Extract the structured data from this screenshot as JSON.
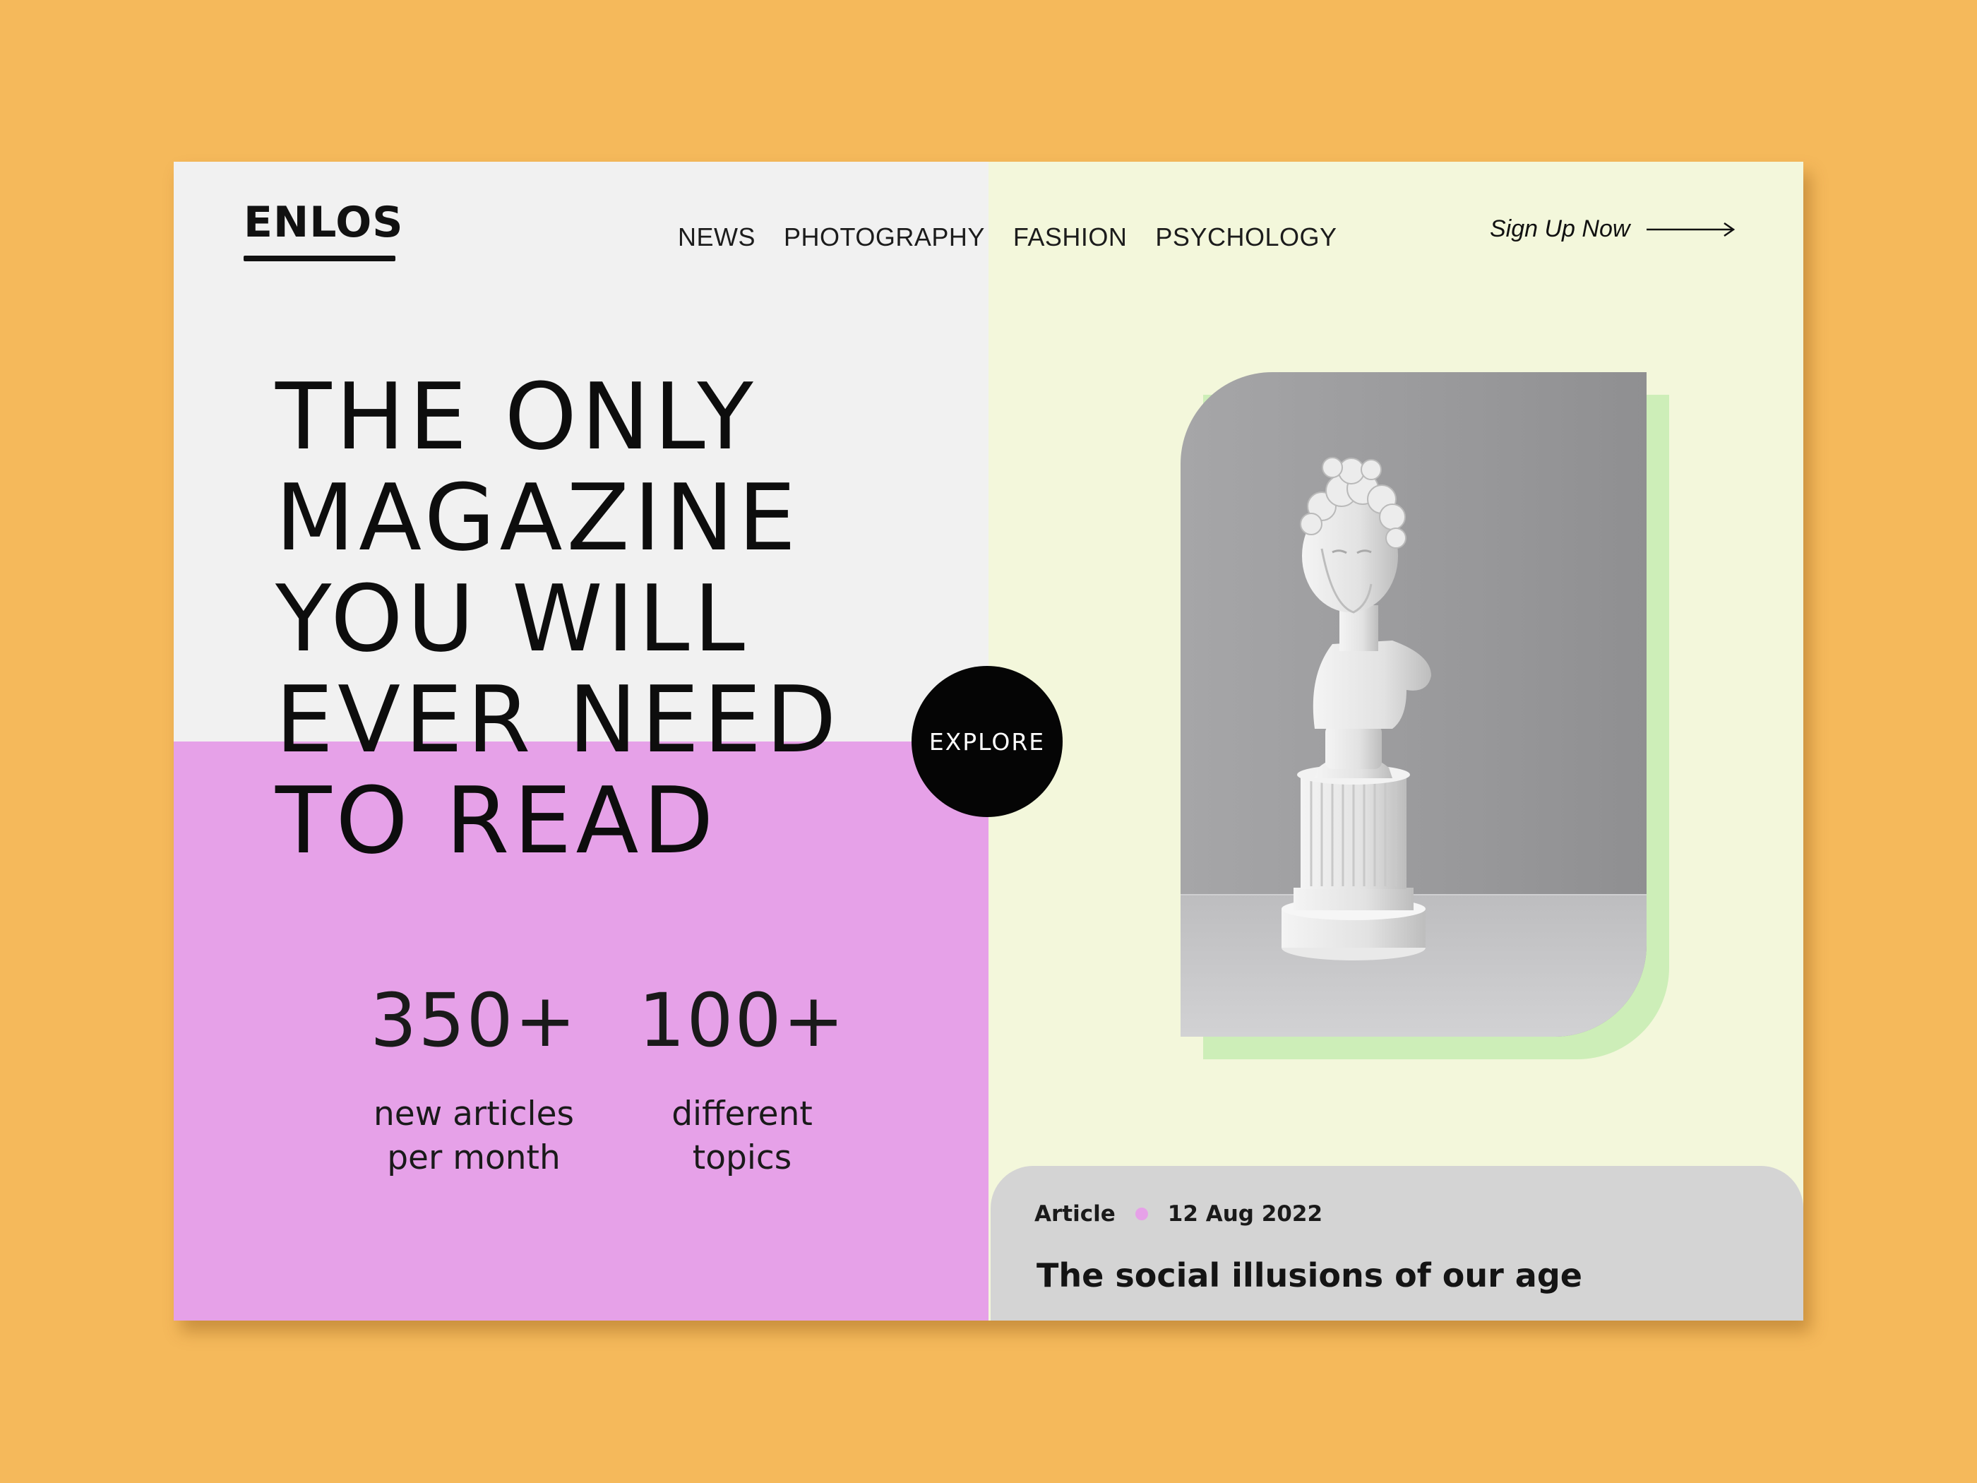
{
  "brand": {
    "logo": "ENLOS"
  },
  "nav": {
    "items": [
      "NEWS",
      "PHOTOGRAPHY",
      "FASHION",
      "PSYCHOLOGY"
    ]
  },
  "signup": {
    "label": "Sign Up Now",
    "icon": "arrow-right-icon"
  },
  "hero": {
    "headline_lines": [
      "THE ONLY",
      "MAGAZINE",
      "YOU WILL",
      "EVER NEED",
      "TO READ"
    ],
    "cta_label": "EXPLORE"
  },
  "stats": [
    {
      "number": "350+",
      "label_line1": "new articles",
      "label_line2": "per month"
    },
    {
      "number": "100+",
      "label_line1": "different",
      "label_line2": "topics"
    }
  ],
  "featured_image": {
    "subject": "white classical bust statue on pedestal"
  },
  "article": {
    "type": "Article",
    "date": "12 Aug 2022",
    "title": "The social illusions of our age"
  },
  "colors": {
    "page_bg": "#F5B95B",
    "left_top_bg": "#F1F1F1",
    "left_bottom_bg": "#E6A1E8",
    "right_bg": "#F3F7DB",
    "photo_accent": "#CDEEB8",
    "article_card_bg": "#D4D4D4",
    "button_bg": "#050505"
  }
}
